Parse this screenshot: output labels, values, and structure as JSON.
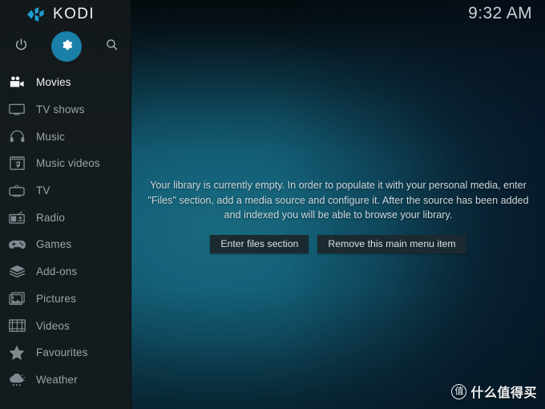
{
  "app": {
    "name": "KODI",
    "logo_icon": "kodi-logo-icon",
    "accent_color": "#1b80a8",
    "sidebar_color": "#141b1e",
    "background_color": "#0d3a4a"
  },
  "header": {
    "clock": "9:32 AM"
  },
  "toolbar": {
    "buttons": [
      {
        "name": "power-icon",
        "label": "Power",
        "selected": false
      },
      {
        "name": "gear-icon",
        "label": "Settings",
        "selected": true
      },
      {
        "name": "search-icon",
        "label": "Search",
        "selected": false
      }
    ]
  },
  "sidebar": {
    "items": [
      {
        "label": "Movies",
        "icon": "movie-camera-icon",
        "active": true
      },
      {
        "label": "TV shows",
        "icon": "tv-monitor-icon",
        "active": false
      },
      {
        "label": "Music",
        "icon": "headphones-icon",
        "active": false
      },
      {
        "label": "Music videos",
        "icon": "music-video-icon",
        "active": false
      },
      {
        "label": "TV",
        "icon": "tv-antenna-icon",
        "active": false
      },
      {
        "label": "Radio",
        "icon": "radio-icon",
        "active": false
      },
      {
        "label": "Games",
        "icon": "gamepad-icon",
        "active": false
      },
      {
        "label": "Add-ons",
        "icon": "package-box-icon",
        "active": false
      },
      {
        "label": "Pictures",
        "icon": "picture-frame-icon",
        "active": false
      },
      {
        "label": "Videos",
        "icon": "film-strip-icon",
        "active": false
      },
      {
        "label": "Favourites",
        "icon": "star-icon",
        "active": false
      },
      {
        "label": "Weather",
        "icon": "cloud-rain-icon",
        "active": false
      }
    ]
  },
  "main": {
    "empty_message": "Your library is currently empty. In order to populate it with your personal media, enter \"Files\" section, add a media source and configure it. After the source has been added and indexed you will be able to browse your library.",
    "buttons": [
      {
        "label": "Enter files section"
      },
      {
        "label": "Remove this main menu item"
      }
    ]
  },
  "watermark": {
    "badge": "值",
    "text": "什么值得买"
  }
}
